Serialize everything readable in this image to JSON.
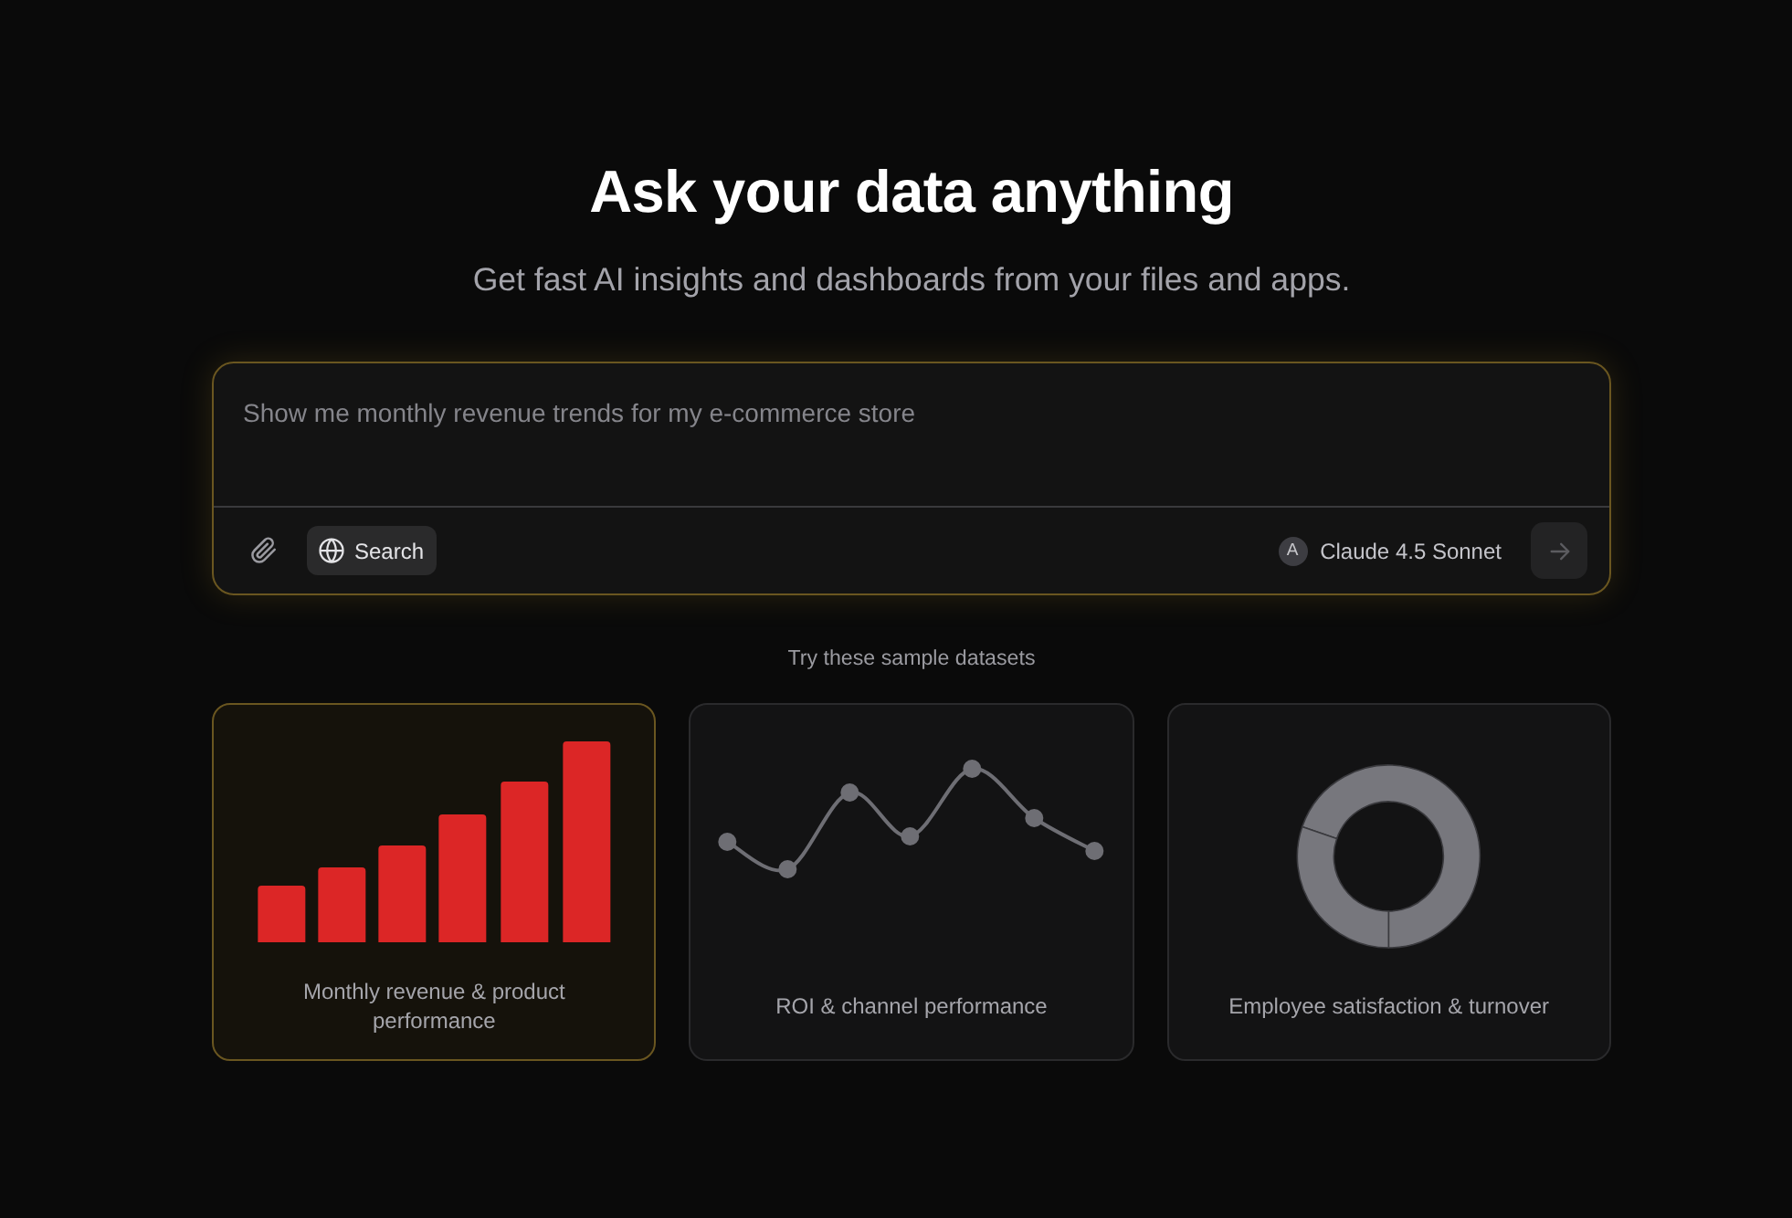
{
  "hero": {
    "title": "Ask your data anything",
    "subtitle": "Get fast AI insights and dashboards from your files and apps."
  },
  "prompt": {
    "placeholder": "Show me monthly revenue trends for my e-commerce store",
    "search_button": "Search",
    "model": {
      "badge": "A",
      "name": "Claude 4.5 Sonnet"
    },
    "send_button": {
      "disabled": true
    }
  },
  "samples": {
    "heading": "Try these sample datasets",
    "cards": [
      {
        "kind": "bar",
        "label": "Monthly revenue & product performance",
        "selected": true
      },
      {
        "kind": "line",
        "label": "ROI & channel performance",
        "selected": false
      },
      {
        "kind": "donut",
        "label": "Employee satisfaction & turnover",
        "selected": false
      }
    ]
  }
}
